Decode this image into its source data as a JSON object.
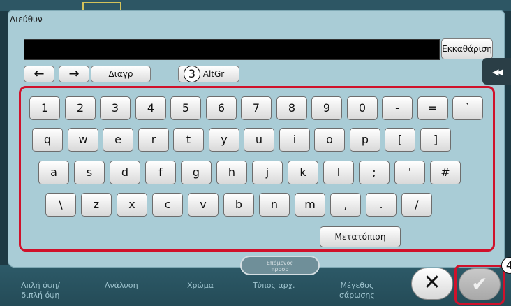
{
  "dialog": {
    "title": "Διεύθυν",
    "address_value": "",
    "clear_label": "Εκκαθάριση",
    "left_arrow": "←",
    "right_arrow": "→",
    "delete_label": "Διαγρ",
    "altgr_label": "AltGr",
    "shift_label": "Μετατόπιση",
    "collapse_icon": "◀◀",
    "next_label_line1": "Επόμενος",
    "next_label_line2": "προορ",
    "cancel_icon": "✕",
    "ok_icon": "✔"
  },
  "callouts": {
    "c3": "3",
    "c4": "4"
  },
  "keyboard": {
    "row1": [
      "1",
      "2",
      "3",
      "4",
      "5",
      "6",
      "7",
      "8",
      "9",
      "0",
      "-",
      "=",
      "`"
    ],
    "row2": [
      "q",
      "w",
      "e",
      "r",
      "t",
      "y",
      "u",
      "i",
      "o",
      "p",
      "[",
      "]"
    ],
    "row3": [
      "a",
      "s",
      "d",
      "f",
      "g",
      "h",
      "j",
      "k",
      "l",
      ";",
      "'",
      "#"
    ],
    "row4": [
      "\\",
      "z",
      "x",
      "c",
      "v",
      "b",
      "n",
      "m",
      ",",
      ".",
      "/"
    ]
  },
  "background_tabs": [
    "Απλή όψη/",
    "διπλή όψη",
    "Ανάλυση",
    "Χρώμα",
    "Τύπος αρχ.",
    "Μέγεθος",
    "σάρωσης"
  ],
  "colors": {
    "panel": "#a9ccd6",
    "highlight": "#d0112b",
    "background": "#1e3a44"
  }
}
